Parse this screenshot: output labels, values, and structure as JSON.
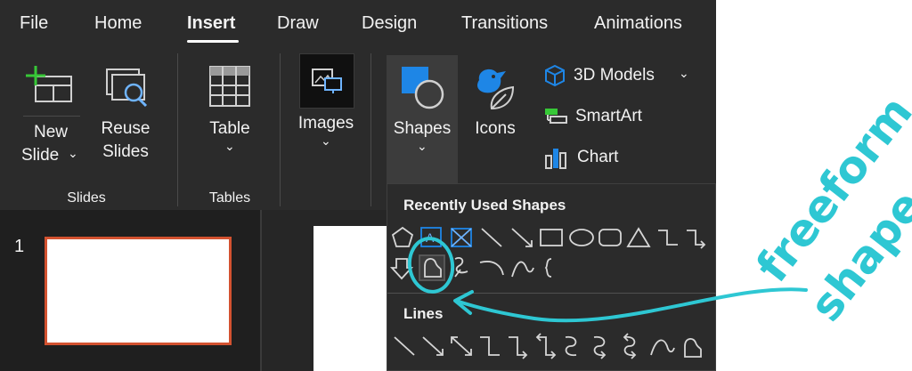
{
  "menu": {
    "tabs": [
      {
        "label": "File"
      },
      {
        "label": "Home"
      },
      {
        "label": "Insert",
        "active": true
      },
      {
        "label": "Draw"
      },
      {
        "label": "Design"
      },
      {
        "label": "Transitions"
      },
      {
        "label": "Animations"
      }
    ]
  },
  "ribbon": {
    "new_slide": {
      "line1": "New",
      "line2": "Slide",
      "chevron": "⌄"
    },
    "reuse_slides": {
      "line1": "Reuse",
      "line2": "Slides"
    },
    "slides_group": "Slides",
    "table": {
      "label": "Table"
    },
    "tables_group": "Tables",
    "images": {
      "label": "Images"
    },
    "shapes": {
      "label": "Shapes"
    },
    "icons": {
      "label": "Icons"
    },
    "models3d": {
      "label": "3D Models"
    },
    "smartart": {
      "label": "SmartArt"
    },
    "chart": {
      "label": "Chart"
    }
  },
  "thumbnails": {
    "slide_number": "1"
  },
  "shapes_dropdown": {
    "recent_header": "Recently Used Shapes",
    "lines_header": "Lines",
    "recent_row1": [
      "pentagon",
      "text-box",
      "text-box-frame",
      "line",
      "arrow",
      "rectangle",
      "oval",
      "rounded-rectangle",
      "triangle",
      "elbow-connector",
      "elbow-arrow-connector"
    ],
    "recent_row2": [
      "down-arrow",
      "freeform-shape",
      "scribble",
      "arc",
      "curve",
      "left-brace"
    ],
    "lines_row": [
      "line",
      "arrow",
      "double-arrow",
      "elbow-connector",
      "elbow-arrow",
      "elbow-double-arrow",
      "curved-connector",
      "curved-arrow",
      "curved-double-arrow",
      "curve",
      "freeform"
    ]
  },
  "annotation": {
    "line1": "freeform",
    "line2": "shape",
    "color": "#2ec7d3"
  },
  "colors": {
    "accent_blue": "#1e86e6",
    "selection_orange": "#d35230",
    "annotation": "#2ec7d3"
  }
}
